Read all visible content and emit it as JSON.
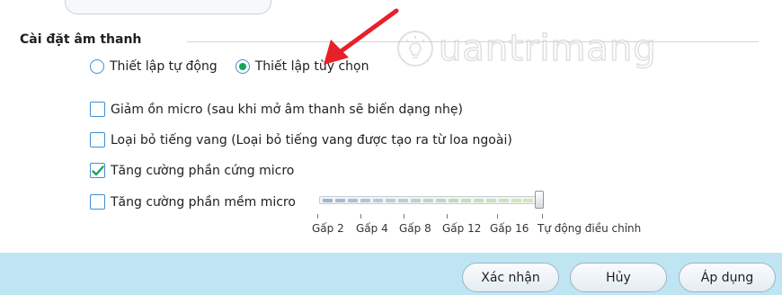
{
  "section": {
    "title": "Cài đặt âm thanh"
  },
  "mode": {
    "auto_label": "Thiết lập tự động",
    "custom_label": "Thiết lập tùy chọn",
    "selected": "custom"
  },
  "options": [
    {
      "label": "Giảm ồn micro (sau khi mở âm thanh sẽ biến dạng nhẹ)",
      "checked": false
    },
    {
      "label": "Loại bỏ tiếng vang (Loại bỏ tiếng vang được tạo ra từ loa ngoài)",
      "checked": false
    },
    {
      "label": "Tăng cường phần cứng micro",
      "checked": true
    },
    {
      "label": "Tăng cường phần mềm micro",
      "checked": false
    }
  ],
  "slider": {
    "ticks": [
      "Gấp 2",
      "Gấp 4",
      "Gấp 8",
      "Gấp 12",
      "Gấp 16",
      "Tự động điều chỉnh"
    ],
    "value_index": 5
  },
  "buttons": {
    "confirm": "Xác nhận",
    "cancel": "Hủy",
    "apply": "Áp dụng"
  },
  "watermark": {
    "text": "uantrimang"
  },
  "colors": {
    "accent_blue": "#3f8fd6",
    "radio_selected": "#1aa35a",
    "check_mark": "#1aa35a",
    "footer": "#bfe5f3",
    "annotation_arrow": "#e8202a"
  }
}
